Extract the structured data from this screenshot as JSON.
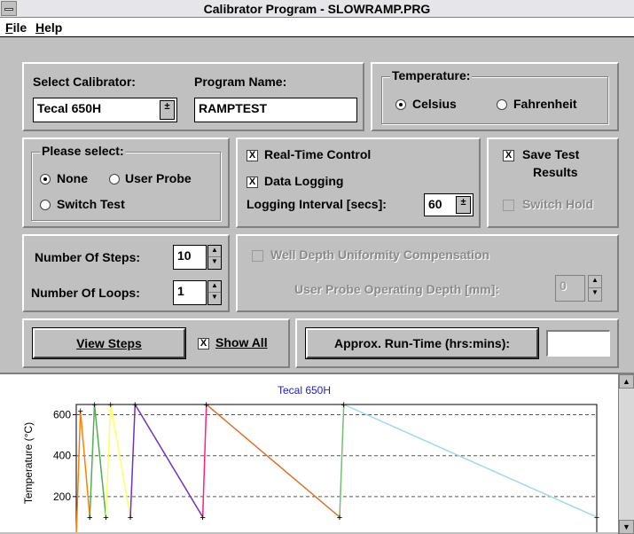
{
  "window": {
    "title": "Calibrator Program - SLOWRAMP.PRG"
  },
  "menu": [
    {
      "label": "File",
      "key": "F",
      "rest": "ile"
    },
    {
      "label": "Help",
      "key": "H",
      "rest": "elp"
    }
  ],
  "calibrator": {
    "label": "Select Calibrator:",
    "value": "Tecal 650H",
    "dropdown_glyph": "±"
  },
  "program": {
    "label": "Program Name:",
    "value": "RAMPTEST"
  },
  "temperature": {
    "label": "Temperature:",
    "celsius": "Celsius",
    "fahrenheit": "Fahrenheit",
    "selected": "Celsius"
  },
  "please_select": {
    "label": "Please select:",
    "none": "None",
    "user_probe": "User Probe",
    "switch_test": "Switch Test",
    "selected": "None"
  },
  "options": {
    "realtime": "Real-Time Control",
    "datalogging": "Data Logging",
    "interval_label": "Logging Interval [secs]:",
    "interval_value": "60",
    "check_mark": "X"
  },
  "save": {
    "line1": "Save Test",
    "line2": "Results",
    "switch_hold": "Switch Hold"
  },
  "steps": {
    "label": "Number Of Steps:",
    "value": "10",
    "loops_label": "Number Of Loops:",
    "loops_value": "1"
  },
  "well_depth": {
    "label": "Well Depth Uniformity Compensation",
    "probe_depth_label": "User Probe Operating Depth [mm]:",
    "probe_depth_value": "0"
  },
  "actions": {
    "view_steps": "View Steps",
    "show_all": "Show All",
    "approx_runtime": "Approx. Run-Time (hrs:mins):",
    "runtime_value": ""
  },
  "chart_data": {
    "type": "line",
    "title": "Tecal 650H",
    "ylabel": "Temperature (°C)",
    "yticks": [
      "600",
      "400",
      "200"
    ],
    "ylim": [
      0,
      650
    ],
    "xlim": [
      0,
      100
    ],
    "grid": "dashed horizontal",
    "series": [
      {
        "color": "#ff8000",
        "points": [
          [
            0,
            0
          ],
          [
            0.8,
            620
          ],
          [
            2.6,
            100
          ]
        ]
      },
      {
        "color": "#50b050",
        "points": [
          [
            2.6,
            100
          ],
          [
            3.5,
            650
          ],
          [
            5.7,
            100
          ]
        ]
      },
      {
        "color": "#ffff60",
        "points": [
          [
            5.7,
            100
          ],
          [
            6.6,
            650
          ],
          [
            10.4,
            100
          ]
        ]
      },
      {
        "color": "#7030c0",
        "points": [
          [
            10.4,
            100
          ],
          [
            11.3,
            650
          ],
          [
            24.3,
            100
          ]
        ]
      },
      {
        "color": "#ff2080",
        "points": [
          [
            24.3,
            100
          ],
          [
            25.0,
            650
          ]
        ]
      },
      {
        "color": "#e07020",
        "points": [
          [
            25.0,
            650
          ],
          [
            50.6,
            100
          ]
        ]
      },
      {
        "color": "#70c070",
        "points": [
          [
            50.6,
            100
          ],
          [
            51.4,
            650
          ]
        ]
      },
      {
        "color": "#a0d8e8",
        "points": [
          [
            51.4,
            650
          ],
          [
            100,
            100
          ]
        ]
      }
    ]
  }
}
